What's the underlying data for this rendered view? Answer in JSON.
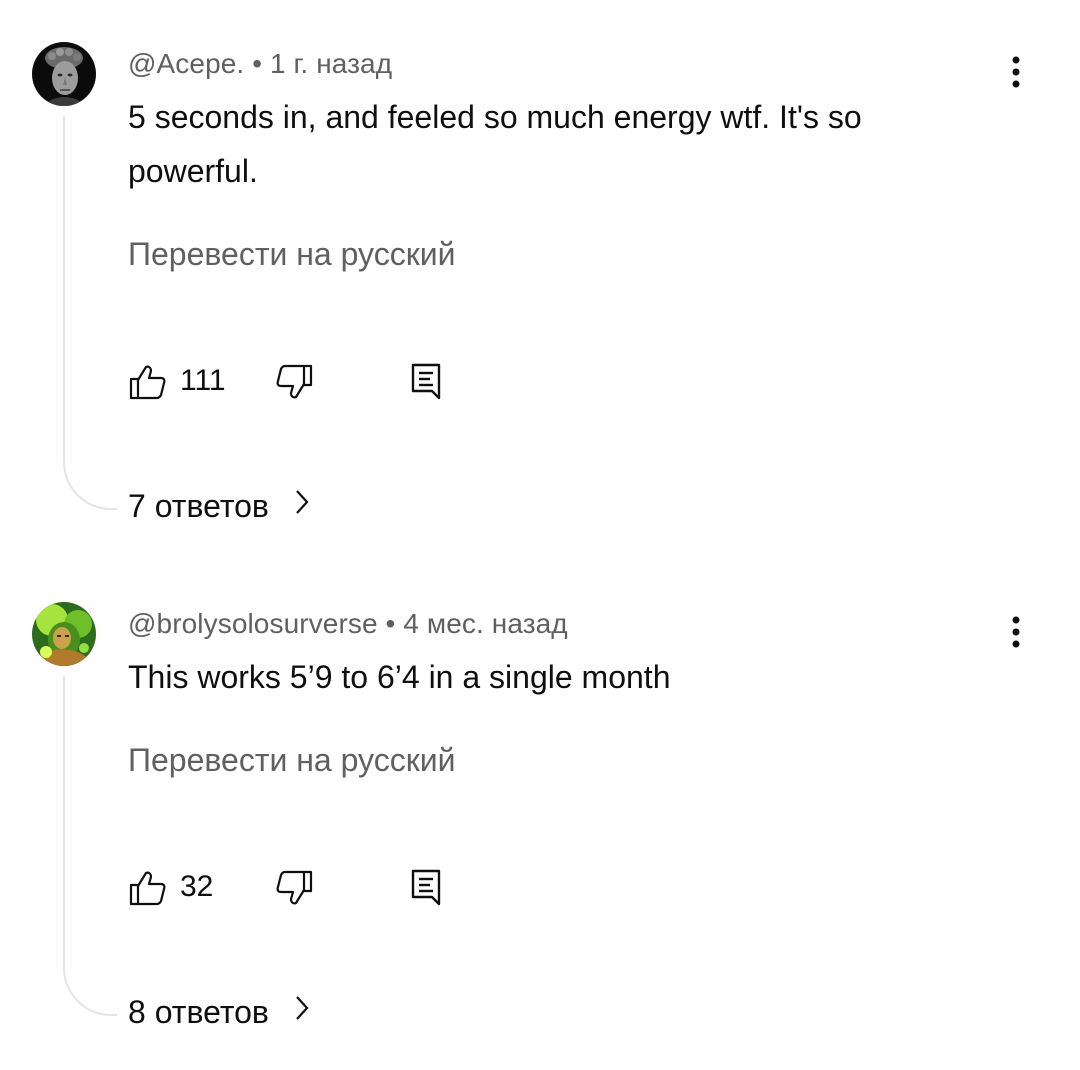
{
  "comments": [
    {
      "author": "@Acepe.",
      "separator": "•",
      "time": "1 г. назад",
      "text": "5 seconds in, and feeled so much energy wtf. It's so powerful.",
      "translate_label": "Перевести на русский",
      "likes": "111",
      "replies_label": "7 ответов",
      "avatar_icon": "statue-avatar-icon"
    },
    {
      "author": "@brolysolosurverse",
      "separator": "•",
      "time": "4 мес. назад",
      "text": "This works 5’9 to 6’4 in a single month",
      "translate_label": "Перевести на русский",
      "likes": "32",
      "replies_label": "8 ответов",
      "avatar_icon": "green-glow-avatar-icon"
    }
  ],
  "icons": {
    "like": "thumbs-up-icon",
    "dislike": "thumbs-down-icon",
    "reply": "reply-comment-icon",
    "more": "more-vertical-icon",
    "expand": "chevron-right-icon"
  },
  "colors": {
    "text": "#0f0f0f",
    "secondary": "#606060",
    "thread_line": "#e5e5e5",
    "background": "#ffffff"
  }
}
